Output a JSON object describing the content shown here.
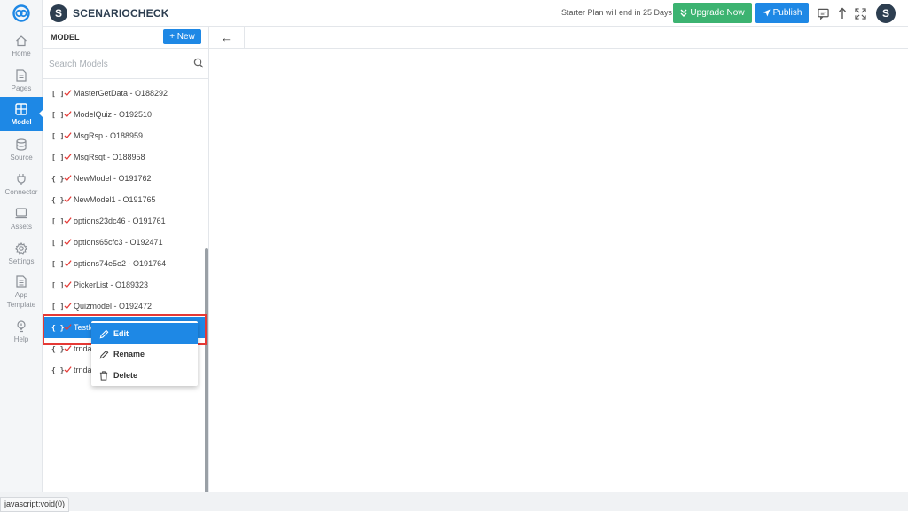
{
  "app": {
    "brand_initial": "S",
    "brand_name": "SCENARIOCHECK",
    "plan_notice": "Starter Plan will end in 25 Days",
    "upgrade_label": "Upgrade Now",
    "publish_label": "Publish",
    "user_initial": "S"
  },
  "rail": {
    "items": [
      {
        "label": "Home",
        "icon": "home-icon"
      },
      {
        "label": "Pages",
        "icon": "page-icon"
      },
      {
        "label": "Model",
        "icon": "grid-icon"
      },
      {
        "label": "Source",
        "icon": "database-icon"
      },
      {
        "label": "Connector",
        "icon": "plug-icon"
      },
      {
        "label": "Assets",
        "icon": "monitor-icon"
      },
      {
        "label": "Settings",
        "icon": "gear-icon"
      },
      {
        "label": "App\nTemplate",
        "icon": "template-icon"
      },
      {
        "label": "Help",
        "icon": "help-icon"
      }
    ],
    "active": "Model"
  },
  "panel": {
    "title": "MODEL",
    "new_label": "+ New",
    "search_placeholder": "Search Models",
    "items": [
      {
        "bracket": "[ ]",
        "name": "MasterGetData - O188292"
      },
      {
        "bracket": "[ ]",
        "name": "ModelQuiz - O192510"
      },
      {
        "bracket": "[ ]",
        "name": "MsgRsp - O188959"
      },
      {
        "bracket": "[ ]",
        "name": "MsgRsqt - O188958"
      },
      {
        "bracket": "{ }",
        "name": "NewModel - O191762"
      },
      {
        "bracket": "{ }",
        "name": "NewModel1 - O191765"
      },
      {
        "bracket": "[ ]",
        "name": "options23dc46 - O191761"
      },
      {
        "bracket": "[ ]",
        "name": "options65cfc3 - O192471"
      },
      {
        "bracket": "[ ]",
        "name": "options74e5e2 - O191764"
      },
      {
        "bracket": "[ ]",
        "name": "PickerList - O189323"
      },
      {
        "bracket": "[ ]",
        "name": "Quizmodel - O192472"
      },
      {
        "bracket": "{ }",
        "name": "TestM"
      },
      {
        "bracket": "{ }",
        "name": "trnda"
      },
      {
        "bracket": "{ }",
        "name": "trnda"
      }
    ],
    "selected_index": 11
  },
  "context_menu": {
    "items": [
      {
        "label": "Edit",
        "icon": "pencil-icon"
      },
      {
        "label": "Rename",
        "icon": "pencil-icon"
      },
      {
        "label": "Delete",
        "icon": "trash-icon"
      }
    ],
    "active_index": 0
  },
  "content": {
    "back_icon": "arrow-left-icon",
    "back_glyph": "←"
  },
  "status": {
    "url": "javascript:void(0)"
  },
  "colors": {
    "accent": "#1e88e5",
    "upgrade": "#3cb371",
    "check": "#e53935",
    "highlight_border": "#e53935"
  }
}
